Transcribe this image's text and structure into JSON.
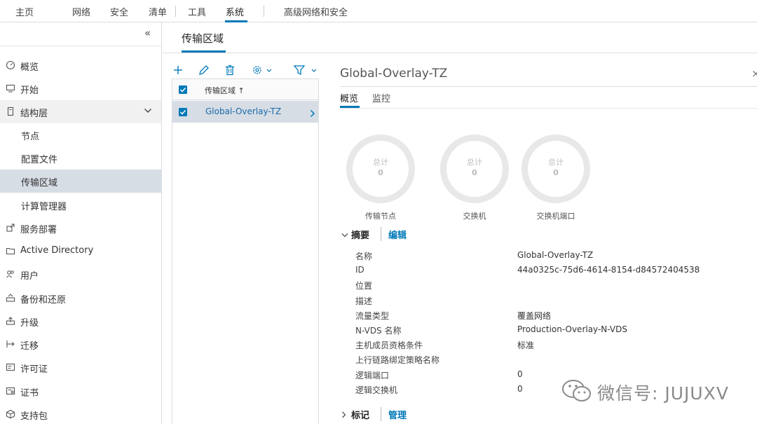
{
  "topnav": {
    "tabs": [
      "主页",
      "网络",
      "安全",
      "清单",
      "工具",
      "系统",
      "高级网络和安全"
    ],
    "active": "系统"
  },
  "sidebar": {
    "collapse_icon": "double-chevron-left-icon",
    "items": [
      {
        "label": "概览",
        "icon": "dashboard-icon"
      },
      {
        "label": "开始",
        "icon": "monitor-icon"
      },
      {
        "label": "结构层",
        "icon": "server-icon"
      },
      {
        "label": "节点"
      },
      {
        "label": "配置文件"
      },
      {
        "label": "传输区域"
      },
      {
        "label": "计算管理器"
      },
      {
        "label": "服务部署",
        "icon": "deploy-icon"
      },
      {
        "label": "Active Directory",
        "icon": "folder-icon"
      },
      {
        "label": "用户",
        "icon": "users-icon"
      },
      {
        "label": "备份和还原",
        "icon": "backup-icon"
      },
      {
        "label": "升级",
        "icon": "upgrade-icon"
      },
      {
        "label": "迁移",
        "icon": "migrate-icon"
      },
      {
        "label": "许可证",
        "icon": "license-icon"
      },
      {
        "label": "证书",
        "icon": "certificate-icon"
      },
      {
        "label": "支持包",
        "icon": "support-bundle-icon"
      }
    ]
  },
  "main": {
    "title": "传输区域",
    "toolbar": [
      "plus-icon",
      "edit-icon",
      "delete-icon",
      "gear-icon",
      "filter-icon"
    ],
    "grid": {
      "header": "传输区域 ↑",
      "rows": [
        "Global-Overlay-TZ"
      ]
    }
  },
  "detail": {
    "title": "Global-Overlay-TZ",
    "close": "×",
    "tabs": [
      "概览",
      "监控"
    ],
    "donuts": [
      {
        "label": "总计",
        "value": "0",
        "caption": "传输节点"
      },
      {
        "label": "总计",
        "value": "0",
        "caption": "交换机"
      },
      {
        "label": "总计",
        "value": "0",
        "caption": "交换机端口"
      }
    ],
    "summary": {
      "title": "摘要",
      "edit": "编辑",
      "rows": [
        {
          "key": "名称",
          "value": "Global-Overlay-TZ"
        },
        {
          "key": "ID",
          "value": "44a0325c-75d6-4614-8154-d84572404538"
        },
        {
          "key": "位置",
          "value": ""
        },
        {
          "key": "描述",
          "value": ""
        },
        {
          "key": "流量类型",
          "value": "覆盖网络"
        },
        {
          "key": "N-VDS 名称",
          "value": "Production-Overlay-N-VDS"
        },
        {
          "key": "主机成员资格条件",
          "value": "标准"
        },
        {
          "key": "上行链路绑定策略名称",
          "value": ""
        },
        {
          "key": "逻辑端口",
          "value": "0"
        },
        {
          "key": "逻辑交换机",
          "value": "0"
        }
      ]
    },
    "tags": {
      "title": "标记",
      "manage": "管理"
    }
  },
  "watermark": {
    "text": "微信号: JUJUXV"
  },
  "colors": {
    "accent": "#0079b8",
    "selected_bg": "#d6dde5",
    "link": "#1a6aa8"
  }
}
